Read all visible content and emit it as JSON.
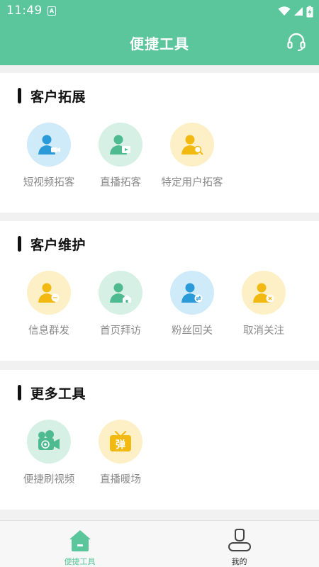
{
  "status_bar": {
    "time": "11:49",
    "notification_badge": "A"
  },
  "header": {
    "title": "便捷工具",
    "accent_color": "#5bc59c",
    "right_icon": "headset-icon"
  },
  "sections": [
    {
      "title": "客户拓展",
      "tools": [
        {
          "label": "短视频拓客",
          "icon": "user-video-icon",
          "color": "blue"
        },
        {
          "label": "直播拓客",
          "icon": "user-live-icon",
          "color": "green"
        },
        {
          "label": "特定用户拓客",
          "icon": "user-search-icon",
          "color": "yellow"
        }
      ]
    },
    {
      "title": "客户维护",
      "tools": [
        {
          "label": "信息群发",
          "icon": "user-message-icon",
          "color": "yellow"
        },
        {
          "label": "首页拜访",
          "icon": "user-home-icon",
          "color": "green"
        },
        {
          "label": "粉丝回关",
          "icon": "user-follow-back-icon",
          "color": "blue"
        },
        {
          "label": "取消关注",
          "icon": "user-unfollow-icon",
          "color": "yellow"
        }
      ]
    },
    {
      "title": "更多工具",
      "tools": [
        {
          "label": "便捷刷视频",
          "icon": "video-camera-icon",
          "color": "green"
        },
        {
          "label": "直播暖场",
          "icon": "tv-danmaku-icon",
          "color": "yellow",
          "glyph": "弹"
        }
      ]
    }
  ],
  "tab_bar": {
    "items": [
      {
        "label": "便捷工具",
        "icon": "home-icon",
        "active": true
      },
      {
        "label": "我的",
        "icon": "profile-icon",
        "active": false
      }
    ]
  }
}
